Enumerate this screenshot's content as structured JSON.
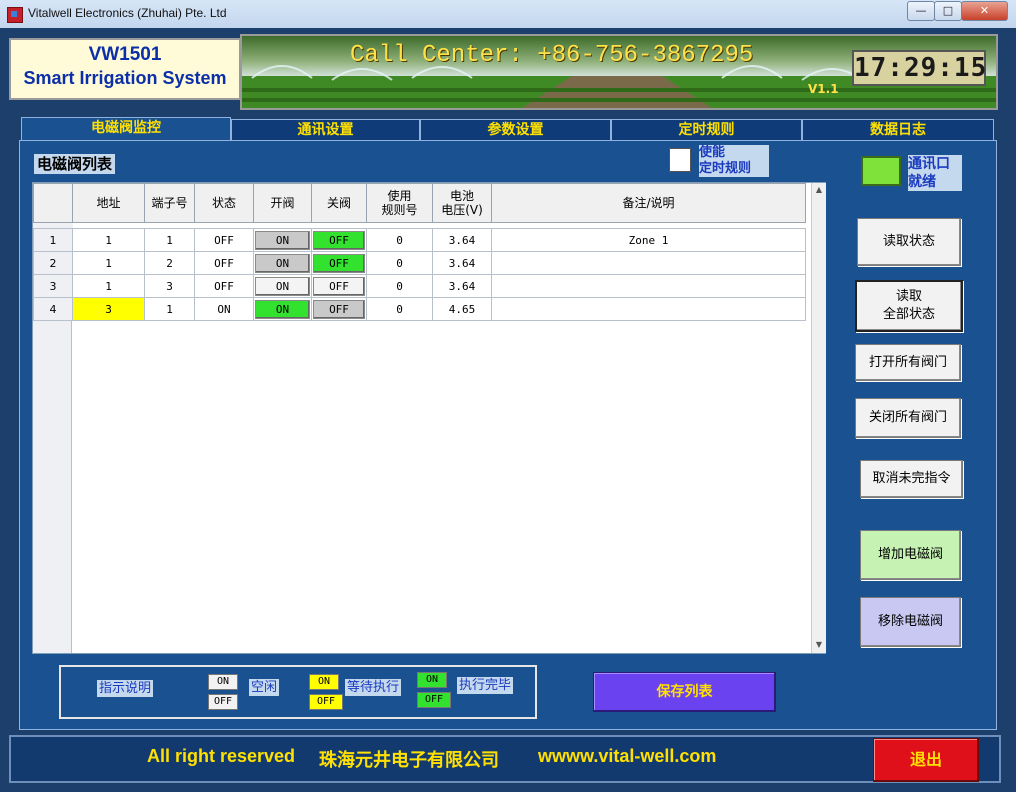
{
  "window": {
    "title": "Vitalwell Electronics (Zhuhai) Pte. Ltd",
    "controls": {
      "minimize": "—",
      "maximize": "□",
      "close": "✕"
    }
  },
  "header": {
    "model": "VW1501",
    "product_name": "Smart Irrigation System",
    "call_center": "Call Center: +86-756-3867295",
    "version": "V1.1",
    "clock": "17:29:15"
  },
  "tabs": [
    {
      "label": "电磁阀监控",
      "active": true
    },
    {
      "label": "通讯设置",
      "active": false
    },
    {
      "label": "参数设置",
      "active": false
    },
    {
      "label": "定时规则",
      "active": false
    },
    {
      "label": "数据日志",
      "active": false
    }
  ],
  "valve_list": {
    "title": "电磁阀列表",
    "enable_schedule": {
      "label_line1": "使能",
      "label_line2": "定时规则",
      "checked": false
    },
    "comm_status": {
      "label_line1": "通讯口",
      "label_line2": "就绪",
      "color": "#7fe23a"
    },
    "columns": {
      "address": "地址",
      "terminal": "端子号",
      "state": "状态",
      "open": "开阀",
      "close": "关阀",
      "rule_line1": "使用",
      "rule_line2": "规则号",
      "battery_line1": "电池",
      "battery_line2": "电压(V)",
      "remark": "备注/说明"
    },
    "rows": [
      {
        "num": "1",
        "address": "1",
        "terminal": "1",
        "state": "OFF",
        "open": "ON",
        "open_style": "gray",
        "close": "OFF",
        "close_style": "green",
        "rule": "0",
        "battery": "3.64",
        "remark": "Zone 1",
        "address_highlight": false
      },
      {
        "num": "2",
        "address": "1",
        "terminal": "2",
        "state": "OFF",
        "open": "ON",
        "open_style": "gray",
        "close": "OFF",
        "close_style": "green",
        "rule": "0",
        "battery": "3.64",
        "remark": "",
        "address_highlight": false
      },
      {
        "num": "3",
        "address": "1",
        "terminal": "3",
        "state": "OFF",
        "open": "ON",
        "open_style": "white",
        "close": "OFF",
        "close_style": "white",
        "rule": "0",
        "battery": "3.64",
        "remark": "",
        "address_highlight": false
      },
      {
        "num": "4",
        "address": "3",
        "terminal": "1",
        "state": "ON",
        "open": "ON",
        "open_style": "green",
        "close": "OFF",
        "close_style": "gray",
        "rule": "0",
        "battery": "4.65",
        "remark": "",
        "address_highlight": true
      }
    ]
  },
  "side_buttons": {
    "read_status": "读取状态",
    "read_all_line1": "读取",
    "read_all_line2": "全部状态",
    "open_all": "打开所有阀门",
    "close_all": "关闭所有阀门",
    "cancel_pending": "取消未完指令",
    "add_valve": "增加电磁阀",
    "remove_valve": "移除电磁阀"
  },
  "legend": {
    "title": "指示说明",
    "idle": {
      "label": "空闲",
      "on": "ON",
      "off": "OFF"
    },
    "pending": {
      "label": "等待执行",
      "on": "ON",
      "off": "OFF"
    },
    "done": {
      "label": "执行完毕",
      "on": "ON",
      "off": "OFF"
    }
  },
  "save_button": "保存列表",
  "footer": {
    "rights": "All right reserved",
    "company": "珠海元井电子有限公司",
    "website": "wwww.vital-well.com",
    "exit": "退出"
  },
  "colors": {
    "background": "#1c3f6c",
    "panel": "#1a5190",
    "accent_text": "#ffe000",
    "led_green": "#33e12f",
    "pending_yellow": "#ffff00",
    "exit_red": "#e0101a",
    "save_purple": "#6a42ef"
  }
}
